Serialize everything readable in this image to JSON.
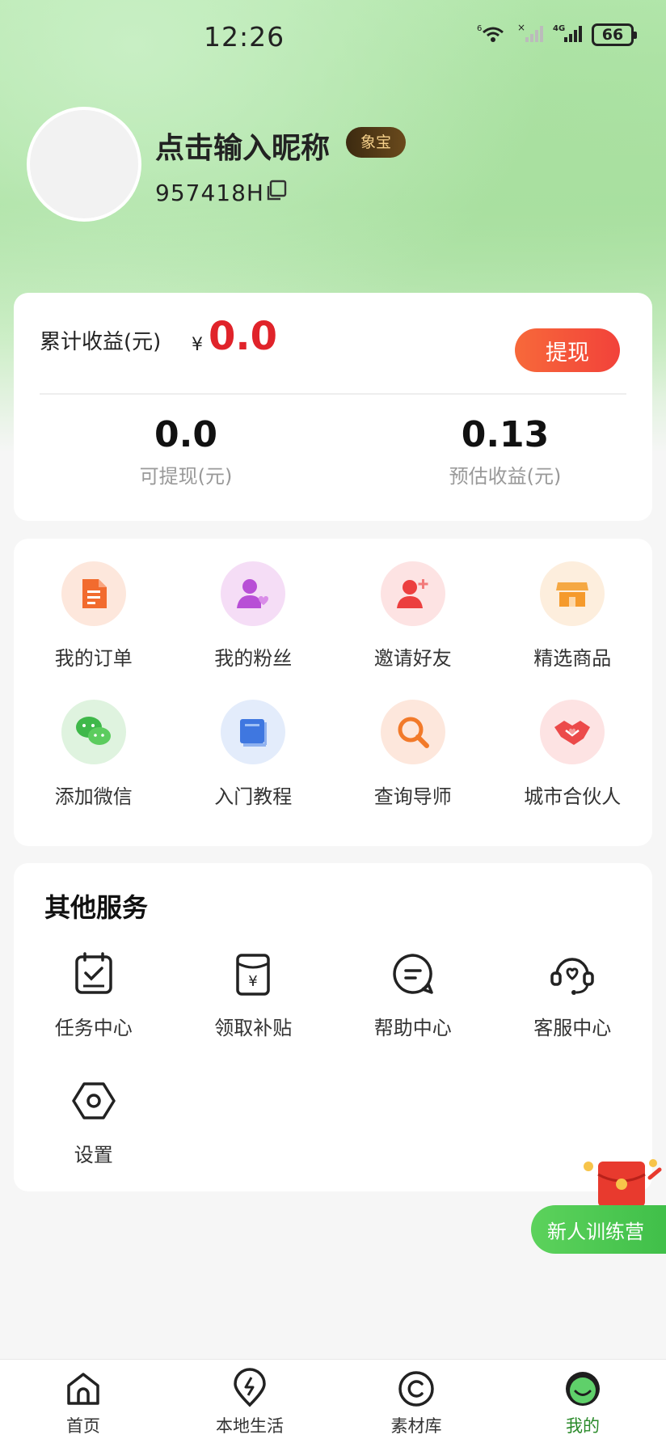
{
  "status_bar": {
    "time": "12:26",
    "wifi_label": "6",
    "network_label": "4G",
    "battery": "66"
  },
  "profile": {
    "nickname": "点击输入昵称",
    "badge": "象宝",
    "uid": "957418H"
  },
  "earnings": {
    "label": "累计收益(元)",
    "currency": "¥",
    "total": "0.0",
    "withdraw_label": "提现",
    "stats": [
      {
        "value": "0.0",
        "label": "可提现(元)"
      },
      {
        "value": "0.13",
        "label": "预估收益(元)"
      }
    ]
  },
  "grid": {
    "items": [
      {
        "label": "我的订单",
        "icon": "order-icon",
        "bg": "#fde7dc",
        "color": "#f26b2e"
      },
      {
        "label": "我的粉丝",
        "icon": "fans-icon",
        "bg": "#f5ddf6",
        "color": "#b84fd6"
      },
      {
        "label": "邀请好友",
        "icon": "invite-icon",
        "bg": "#fde3e3",
        "color": "#ec3f3f"
      },
      {
        "label": "精选商品",
        "icon": "shop-icon",
        "bg": "#fdeedd",
        "color": "#f59a2c"
      },
      {
        "label": "添加微信",
        "icon": "wechat-icon",
        "bg": "#dff3df",
        "color": "#3fb84a"
      },
      {
        "label": "入门教程",
        "icon": "book-icon",
        "bg": "#e3ecfb",
        "color": "#3f77e0"
      },
      {
        "label": "查询导师",
        "icon": "search-icon",
        "bg": "#fde7dc",
        "color": "#f27a2a"
      },
      {
        "label": "城市合伙人",
        "icon": "handshake-icon",
        "bg": "#fde3e3",
        "color": "#ec4a4a"
      }
    ]
  },
  "services": {
    "title": "其他服务",
    "items": [
      {
        "label": "任务中心",
        "icon": "task-icon"
      },
      {
        "label": "领取补贴",
        "icon": "subsidy-icon"
      },
      {
        "label": "帮助中心",
        "icon": "help-icon"
      },
      {
        "label": "客服中心",
        "icon": "support-icon"
      },
      {
        "label": "设置",
        "icon": "settings-icon"
      }
    ]
  },
  "promo": {
    "label": "新人训练营"
  },
  "bottom_nav": {
    "items": [
      {
        "label": "首页",
        "icon": "home-icon"
      },
      {
        "label": "本地生活",
        "icon": "local-life-icon"
      },
      {
        "label": "素材库",
        "icon": "materials-icon"
      },
      {
        "label": "我的",
        "icon": "profile-icon",
        "active": true
      }
    ]
  },
  "colors": {
    "accent": "#e0232a",
    "active_nav": "#2a8a2a",
    "promo_green": "#3ebe48"
  }
}
